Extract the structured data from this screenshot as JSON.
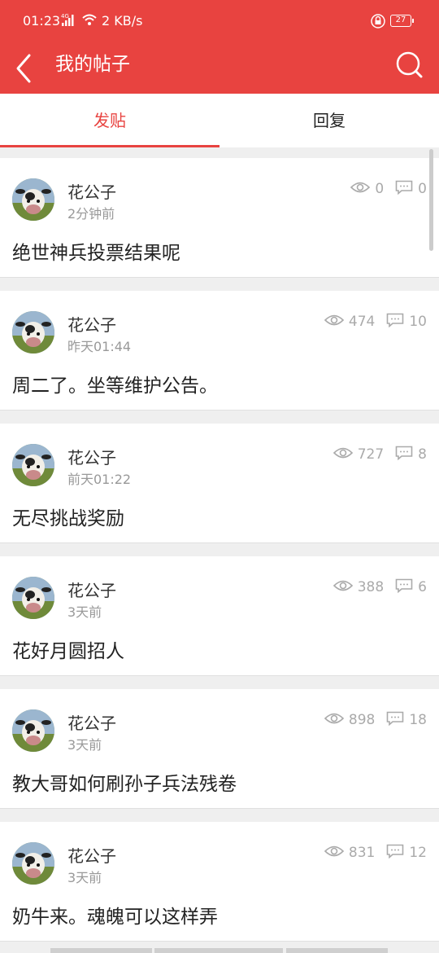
{
  "status": {
    "time": "01:23",
    "net_label": "4G",
    "speed": "2 KB/s",
    "battery": "27"
  },
  "header": {
    "title": "我的帖子"
  },
  "tabs": [
    {
      "label": "发贴",
      "active": true
    },
    {
      "label": "回复",
      "active": false
    }
  ],
  "posts": [
    {
      "author": "花公子",
      "time": "2分钟前",
      "views": "0",
      "comments": "0",
      "content": "绝世神兵投票结果呢"
    },
    {
      "author": "花公子",
      "time": "昨天01:44",
      "views": "474",
      "comments": "10",
      "content": "周二了。坐等维护公告。"
    },
    {
      "author": "花公子",
      "time": "前天01:22",
      "views": "727",
      "comments": "8",
      "content": "无尽挑战奖励"
    },
    {
      "author": "花公子",
      "time": "3天前",
      "views": "388",
      "comments": "6",
      "content": "花好月圆招人"
    },
    {
      "author": "花公子",
      "time": "3天前",
      "views": "898",
      "comments": "18",
      "content": "教大哥如何刷孙子兵法残卷"
    },
    {
      "author": "花公子",
      "time": "3天前",
      "views": "831",
      "comments": "12",
      "content": "奶牛来。魂魄可以这样弄"
    }
  ],
  "colors": {
    "accent": "#e84340",
    "icon_gray": "#aaaaaa"
  },
  "icons": {
    "back": "chevron-left-icon",
    "search": "search-icon",
    "views": "eye-icon",
    "comments": "comment-icon",
    "avatar": "cow-avatar"
  }
}
